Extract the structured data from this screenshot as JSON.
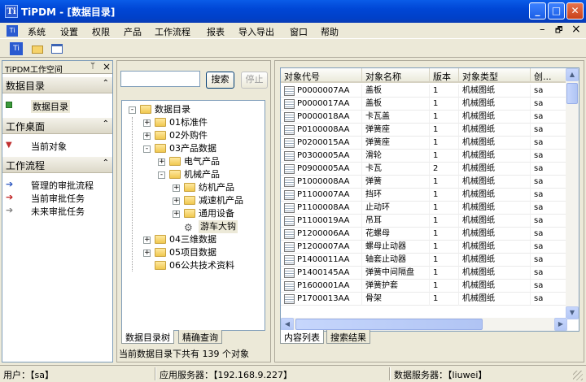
{
  "window": {
    "app_short": "TiPDM",
    "title": "TiPDM - [数据目录]",
    "min": "_",
    "max": "□",
    "close": "✕"
  },
  "menu": {
    "items": [
      "系统",
      "设置",
      "权限",
      "产品",
      "工作流程",
      "报表",
      "导入导出",
      "窗口",
      "帮助"
    ],
    "mdi_min": "–",
    "mdi_restore": "🗗",
    "mdi_close": "×"
  },
  "left": {
    "header": "TiPDM工作空间",
    "pin": "ᛘ",
    "close": "×",
    "sections": [
      {
        "title": "数据目录",
        "items": [
          "数据目录"
        ]
      },
      {
        "title": "工作桌面",
        "items": [
          "当前对象"
        ]
      },
      {
        "title": "工作流程",
        "items": [
          "管理的审批流程",
          "当前审批任务",
          "未来审批任务"
        ]
      }
    ],
    "chev": "⌃"
  },
  "search": {
    "value": "",
    "search_btn": "搜索",
    "stop_btn": "停止"
  },
  "tree": {
    "root": "数据目录",
    "nodes": [
      {
        "label": "01标准件",
        "level": 1,
        "expander": "+"
      },
      {
        "label": "02外购件",
        "level": 1,
        "expander": "+"
      },
      {
        "label": "03产品数据",
        "level": 1,
        "expander": "-"
      },
      {
        "label": "电气产品",
        "level": 2,
        "expander": "+"
      },
      {
        "label": "机械产品",
        "level": 2,
        "expander": "-"
      },
      {
        "label": "纺机产品",
        "level": 3,
        "expander": "+"
      },
      {
        "label": "减速机产品",
        "level": 3,
        "expander": "+"
      },
      {
        "label": "通用设备",
        "level": 3,
        "expander": "+"
      },
      {
        "label": "游车大钩",
        "level": 3,
        "expander": ""
      },
      {
        "label": "04三维数据",
        "level": 1,
        "expander": "+"
      },
      {
        "label": "05项目数据",
        "level": 1,
        "expander": "+"
      },
      {
        "label": "06公共技术资料",
        "level": 1,
        "expander": ""
      }
    ],
    "root_expander": "-"
  },
  "mid_tabs": [
    "数据目录树",
    "精确查询"
  ],
  "mid_status": "当前数据目录下共有 139 个对象",
  "grid": {
    "columns": [
      "对象代号",
      "对象名称",
      "版本",
      "对象类型",
      "创..."
    ],
    "rows": [
      [
        "P0000007AA",
        "盖板",
        "1",
        "机械图纸",
        "sa"
      ],
      [
        "P0000017AA",
        "盖板",
        "1",
        "机械图纸",
        "sa"
      ],
      [
        "P0000018AA",
        "卡瓦盖",
        "1",
        "机械图纸",
        "sa"
      ],
      [
        "P0100008AA",
        "弹簧座",
        "1",
        "机械图纸",
        "sa"
      ],
      [
        "P0200015AA",
        "弹簧座",
        "1",
        "机械图纸",
        "sa"
      ],
      [
        "P0300005AA",
        "滑轮",
        "1",
        "机械图纸",
        "sa"
      ],
      [
        "P0900005AA",
        "卡瓦",
        "2",
        "机械图纸",
        "sa"
      ],
      [
        "P1000008AA",
        "弹簧",
        "1",
        "机械图纸",
        "sa"
      ],
      [
        "P1100007AA",
        "挡环",
        "1",
        "机械图纸",
        "sa"
      ],
      [
        "P1100008AA",
        "止动环",
        "1",
        "机械图纸",
        "sa"
      ],
      [
        "P1100019AA",
        "吊耳",
        "1",
        "机械图纸",
        "sa"
      ],
      [
        "P1200006AA",
        "花螺母",
        "1",
        "机械图纸",
        "sa"
      ],
      [
        "P1200007AA",
        "螺母止动器",
        "1",
        "机械图纸",
        "sa"
      ],
      [
        "P1400011AA",
        "轴套止动器",
        "1",
        "机械图纸",
        "sa"
      ],
      [
        "P1400145AA",
        "弹簧中间隔盘",
        "1",
        "机械图纸",
        "sa"
      ],
      [
        "P1600001AA",
        "弹簧护套",
        "1",
        "机械图纸",
        "sa"
      ],
      [
        "P1700013AA",
        "骨架",
        "1",
        "机械图纸",
        "sa"
      ]
    ]
  },
  "right_tabs": [
    "内容列表",
    "搜索结果"
  ],
  "status": {
    "user": "用户：【sa】",
    "app_server": "应用服务器：【192.168.9.227】",
    "db_server": "数据服务器：【liuwei】"
  },
  "colors": {
    "titlebar": "#0046d5",
    "accent": "#316ac5",
    "chrome": "#ece9d8"
  }
}
